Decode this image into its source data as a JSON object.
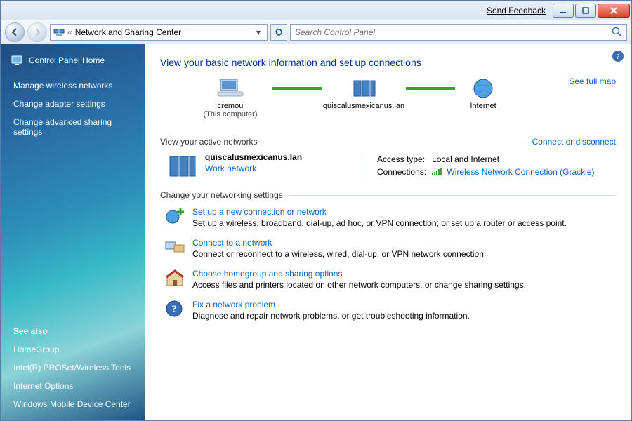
{
  "titlebar": {
    "feedback": "Send Feedback"
  },
  "nav": {
    "breadcrumb_prefix": "«",
    "breadcrumb": "Network and Sharing Center",
    "search_placeholder": "Search Control Panel"
  },
  "sidebar": {
    "home": "Control Panel Home",
    "links": [
      "Manage wireless networks",
      "Change adapter settings",
      "Change advanced sharing settings"
    ],
    "seealso_heading": "See also",
    "seealso": [
      "HomeGroup",
      "Intel(R) PROSet/Wireless Tools",
      "Internet Options",
      "Windows Mobile Device Center"
    ]
  },
  "main": {
    "title": "View your basic network information and set up connections",
    "fullmap": "See full map",
    "nodes": {
      "computer_name": "cremou",
      "computer_sub": "(This computer)",
      "router_name": "quiscalusmexicanus.lan",
      "internet_name": "Internet"
    },
    "active_heading": "View your active networks",
    "connect_link": "Connect or disconnect",
    "active": {
      "name": "quiscalusmexicanus.lan",
      "type_link": "Work network",
      "access_label": "Access type:",
      "access_value": "Local and Internet",
      "conn_label": "Connections:",
      "conn_link": "Wireless Network Connection (Grackle)"
    },
    "settings_heading": "Change your networking settings",
    "settings": [
      {
        "head": "Set up a new connection or network",
        "desc": "Set up a wireless, broadband, dial-up, ad hoc, or VPN connection; or set up a router or access point."
      },
      {
        "head": "Connect to a network",
        "desc": "Connect or reconnect to a wireless, wired, dial-up, or VPN network connection."
      },
      {
        "head": "Choose homegroup and sharing options",
        "desc": "Access files and printers located on other network computers, or change sharing settings."
      },
      {
        "head": "Fix a network problem",
        "desc": "Diagnose and repair network problems, or get troubleshooting information."
      }
    ]
  }
}
